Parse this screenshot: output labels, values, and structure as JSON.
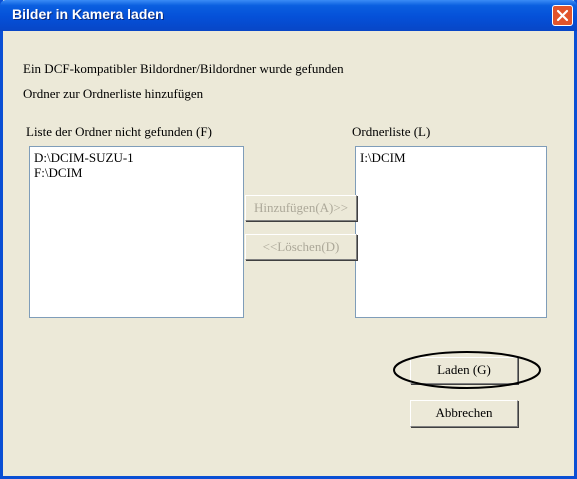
{
  "window": {
    "title": "Bilder in Kamera laden",
    "close_icon": "close-icon",
    "accent_color": "#0a5fe0",
    "close_color": "#e2542b"
  },
  "messages": {
    "found": "Ein DCF-kompatibler Bildordner/Bildordner wurde gefunden",
    "instruction": "Ordner zur Ordnerliste hinzufügen"
  },
  "left_list": {
    "label": "Liste der Ordner nicht gefunden (F)",
    "items": [
      "D:\\DCIM-SUZU-1",
      "F:\\DCIM"
    ]
  },
  "right_list": {
    "label": "Ordnerliste (L)",
    "items": [
      "I:\\DCIM"
    ]
  },
  "buttons": {
    "add": "Hinzufügen(A)>>",
    "delete": "<<Löschen(D)",
    "load": "Laden (G)",
    "cancel": "Abbrechen"
  }
}
